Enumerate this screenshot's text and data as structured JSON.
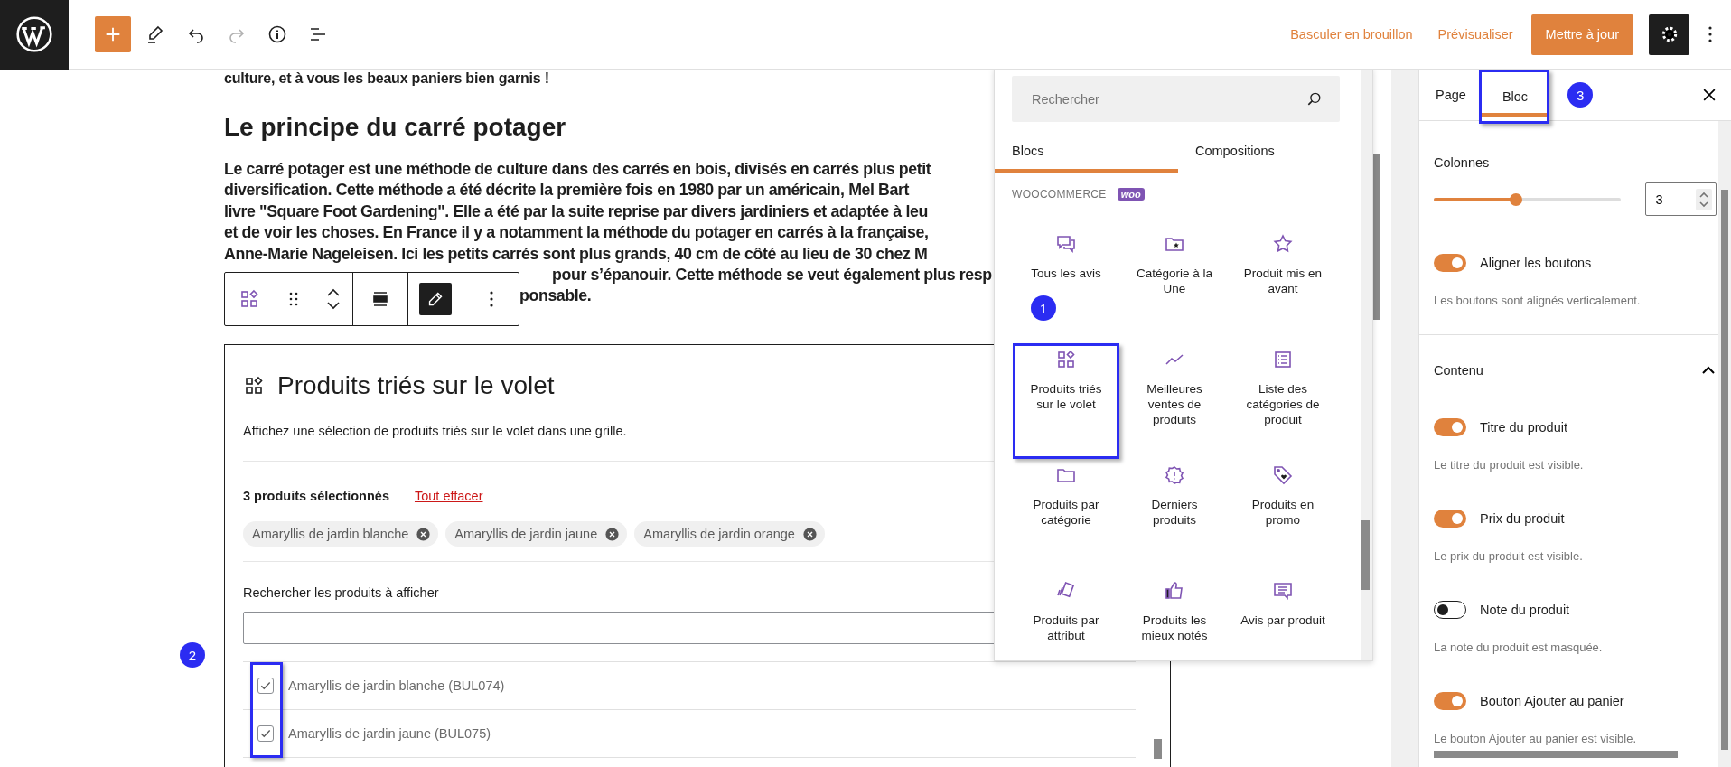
{
  "top_bar": {
    "redo_disabled": true,
    "settings_active": true,
    "draft_link": "Basculer en brouillon",
    "preview_link": "Prévisualiser",
    "update_button": "Mettre à jour"
  },
  "editor": {
    "intro_line": "culture, et à vous les beaux paniers bien garnis !",
    "heading": "Le principe du carré potager",
    "paragraph_lines": [
      "Le carré potager est une méthode de culture dans des carrés en bois, divisés en carrés plus petit",
      "diversification. Cette méthode a été décrite la première fois en 1980 par un américain, Mel Bart",
      "livre \"Square Foot Gardening\". Elle a été par la suite reprise par divers jardiniers et adaptée à leu",
      "et de voir les choses. En France il y a notamment la méthode du potager en carrés à la française,",
      "Anne-Marie Nageleisen. Ici les petits carrés sont plus grands, 40 cm de côté au lieu de 30 chez M"
    ],
    "paragraph_lines_beside_toolbar": [
      "pour s’épanouir. Cette méthode se veut également plus resp",
      "ponsable."
    ],
    "block_toolbar": {
      "edit_selected": true
    },
    "badge": "2",
    "block": {
      "title": "Produits triés sur le volet",
      "description": "Affichez une sélection de produits triés sur le volet dans une grille.",
      "selected_count": "3 produits sélectionnés",
      "clear_link": "Tout effacer",
      "chips": [
        "Amaryllis de jardin blanche",
        "Amaryllis de jardin jaune",
        "Amaryllis de jardin orange"
      ],
      "search_label": "Rechercher les produits à afficher",
      "products": [
        {
          "label": "Amaryllis de jardin blanche (BUL074)",
          "checked": true,
          "highlighted": true
        },
        {
          "label": "Amaryllis de jardin jaune (BUL075)",
          "checked": true,
          "highlighted": true
        }
      ]
    }
  },
  "inserter": {
    "search_placeholder": "Rechercher",
    "tabs": [
      {
        "label": "Blocs",
        "selected": true
      },
      {
        "label": "Compositions",
        "selected": false
      }
    ],
    "category": "WOOCOMMERCE",
    "category_badge": "woo",
    "badge": "1",
    "blocks": [
      {
        "label": "Tous les avis",
        "kind": "reviews",
        "highlighted": false
      },
      {
        "label": "Catégorie à la Une",
        "kind": "featured-category",
        "highlighted": false
      },
      {
        "label": "Produit mis en avant",
        "kind": "star",
        "highlighted": false
      },
      {
        "label": "Produits triés sur le volet",
        "kind": "hand-picked",
        "highlighted": true
      },
      {
        "label": "Meilleures ventes de produits",
        "kind": "trend",
        "highlighted": false
      },
      {
        "label": "Liste des catégories de produit",
        "kind": "list",
        "highlighted": false
      },
      {
        "label": "Produits par catégorie",
        "kind": "folder",
        "highlighted": false
      },
      {
        "label": "Derniers produits",
        "kind": "new",
        "highlighted": false
      },
      {
        "label": "Produits en promo",
        "kind": "tag",
        "highlighted": false
      },
      {
        "label": "Produits par attribut",
        "kind": "cards",
        "highlighted": false
      },
      {
        "label": "Produits les mieux notés",
        "kind": "thumb",
        "highlighted": false
      },
      {
        "label": "Avis par produit",
        "kind": "comment",
        "highlighted": false
      }
    ]
  },
  "sidebar": {
    "tabs": [
      {
        "label": "Page",
        "selected": false,
        "highlighted": false
      },
      {
        "label": "Bloc",
        "selected": true,
        "highlighted": true
      }
    ],
    "badge": "3",
    "columns_label": "Colonnes",
    "columns_slider": {
      "level": 0.41
    },
    "columns_value": "3",
    "layout_toggles": [
      {
        "label": "Aligner les boutons",
        "on": true,
        "help": "Les boutons sont alignés verticalement."
      }
    ],
    "content_section": {
      "title": "Contenu",
      "expanded": true,
      "toggles": [
        {
          "label": "Titre du produit",
          "on": true,
          "help": "Le titre du produit est visible."
        },
        {
          "label": "Prix du produit",
          "on": true,
          "help": "Le prix du produit est visible."
        },
        {
          "label": "Note du produit",
          "on": false,
          "help": "La note du produit est masquée."
        },
        {
          "label": "Bouton Ajouter au panier",
          "on": true,
          "help": "Le bouton Ajouter au panier est visible."
        }
      ]
    }
  }
}
